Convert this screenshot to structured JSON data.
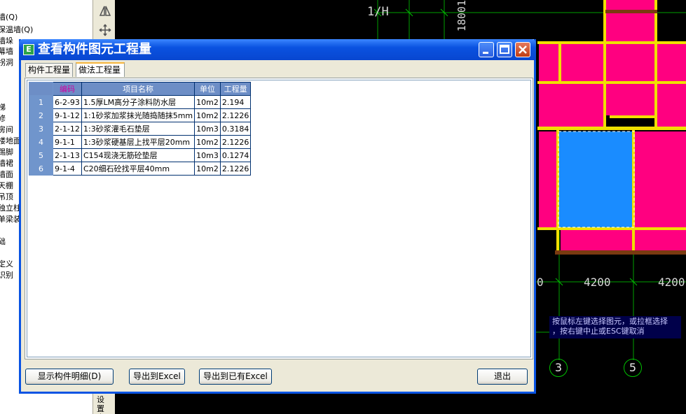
{
  "tree": {
    "items": [
      "墙(Q)",
      "保温墙(Q)",
      "墙垛",
      "幕墙",
      "拐洞",
      "",
      "",
      "",
      "梯",
      "修",
      "房间",
      "楼地面",
      "踢脚",
      "墙裙",
      "墙面",
      "天棚",
      "吊顶",
      "独立柱",
      "单梁装",
      "",
      "础",
      "",
      "定义",
      "识别"
    ]
  },
  "toolbar": {
    "icons": [
      "triangle-mirror-icon",
      "move-cross-icon"
    ]
  },
  "bottom_vertical_text": "设置点",
  "cad": {
    "axis_label_1h": "1/H",
    "dim_vertical": "18001",
    "dim_0": "0",
    "dim_4200_a": "4200",
    "dim_4200_b": "4200",
    "axis_3": "3",
    "axis_5": "5",
    "tip_line1": "按鼠标左键选择图元，或拉框选择",
    "tip_line2": "，按右键中止或ESC键取消"
  },
  "dialog": {
    "title": "查看构件图元工程量",
    "icon_letter": "E",
    "tabs": [
      "构件工程量",
      "做法工程量"
    ],
    "active_tab": "做法工程量",
    "table": {
      "headers": [
        "编码",
        "项目名称",
        "单位",
        "工程量"
      ],
      "rows": [
        {
          "n": "1",
          "code": "6-2-93",
          "name": "1.5厚LM高分子涂料防水层",
          "unit": "10m2",
          "qty": "2.194"
        },
        {
          "n": "2",
          "code": "9-1-12",
          "name": "1:1砂浆加浆抹光随捣随抹5mm",
          "unit": "10m2",
          "qty": "2.1226"
        },
        {
          "n": "3",
          "code": "2-1-12",
          "name": "1:3砂浆灌毛石垫层",
          "unit": "10m3",
          "qty": "0.3184"
        },
        {
          "n": "4",
          "code": "9-1-1",
          "name": "1:3砂浆硬基层上找平层20mm",
          "unit": "10m2",
          "qty": "2.1226"
        },
        {
          "n": "5",
          "code": "2-1-13",
          "name": "C154现浇无筋砼垫层",
          "unit": "10m3",
          "qty": "0.1274"
        },
        {
          "n": "6",
          "code": "9-1-4",
          "name": "C20细石砼找平层40mm",
          "unit": "10m2",
          "qty": "2.1226"
        }
      ]
    },
    "buttons": {
      "show_detail": "显示构件明细(D)",
      "export_excel": "导出到Excel",
      "export_existing": "导出到已有Excel",
      "exit": "退出"
    }
  },
  "colors": {
    "room_magenta": "#ff0080",
    "room_blue": "#1a8cff",
    "wall_yellow": "#f0e000",
    "axis_green": "#00c000"
  }
}
